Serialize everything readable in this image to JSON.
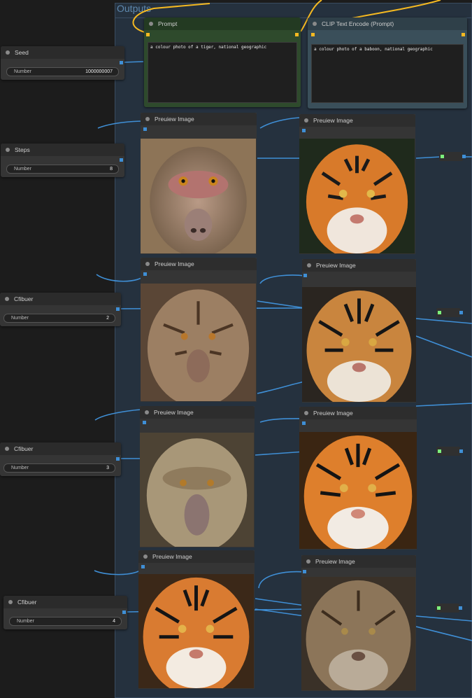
{
  "group": {
    "title": "Outputs"
  },
  "prompt_node": {
    "title": "Prompt",
    "text": "a colour photo of a tiger, national geographic"
  },
  "clip_node": {
    "title": "CLIP Text Encode (Prompt)",
    "text": "a colour photo of a baboon, national geographic"
  },
  "seed_node": {
    "title": "Seed",
    "widget_label": "Number",
    "widget_value": "1000000007"
  },
  "steps_node": {
    "title": "Steps",
    "widget_label": "Number",
    "widget_value": "8"
  },
  "cfg_nodes": [
    {
      "title": "Cfibuer",
      "widget_label": "Number",
      "widget_value": "2"
    },
    {
      "title": "Cfibuer",
      "widget_label": "Number",
      "widget_value": "3"
    },
    {
      "title": "Cfibuer",
      "widget_label": "Number",
      "widget_value": "4"
    }
  ],
  "preview_title": "Preuiew Image",
  "colors": {
    "group_bg": "#25313e",
    "wire_blue": "#3f8fd6",
    "wire_yellow": "#f5b921",
    "prompt_green": "#2e4a2c",
    "clip_slate": "#3a4f5a"
  }
}
